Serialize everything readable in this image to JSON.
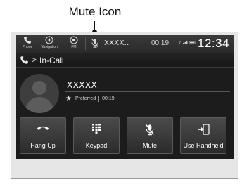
{
  "callout": {
    "label": "Mute Icon"
  },
  "statusbar": {
    "phone_label": "Phone",
    "navigation_label": "Navigation",
    "fm_label": "FM",
    "contact_name": "XXXX..",
    "call_duration": "00:19",
    "signal_text": "0",
    "clock": "12:34"
  },
  "breadcrumb": {
    "title": "In-Call"
  },
  "caller": {
    "name": "XXXXX",
    "preferred_label": "Preferred",
    "duration": "00:19"
  },
  "buttons": {
    "hang_up": "Hang Up",
    "keypad": "Keypad",
    "mute": "Mute",
    "use_handheld": "Use Handheld"
  }
}
